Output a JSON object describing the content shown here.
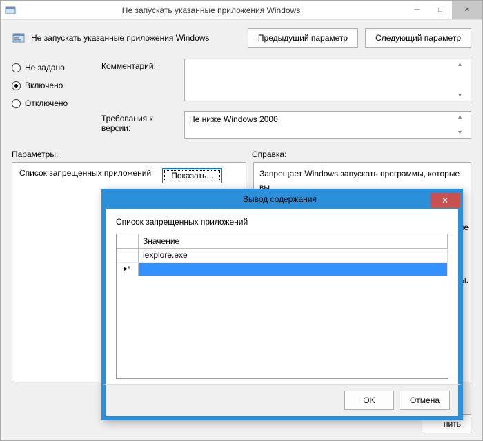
{
  "window": {
    "title": "Не запускать указанные приложения Windows",
    "header_label": "Не запускать указанные приложения Windows",
    "prev_btn": "Предыдущий параметр",
    "next_btn": "Следующий параметр"
  },
  "state": {
    "not_configured": "Не задано",
    "enabled": "Включено",
    "disabled": "Отключено",
    "selected": "enabled"
  },
  "fields": {
    "comment_label": "Комментарий:",
    "comment_value": "",
    "requirements_label": "Требования к версии:",
    "requirements_value": "Не ниже Windows 2000"
  },
  "sections": {
    "params_label": "Параметры:",
    "help_label": "Справка:"
  },
  "params_panel": {
    "list_label": "Список запрещенных приложений",
    "show_btn": "Показать..."
  },
  "help_panel": {
    "line1": "Запрещает Windows запускать программы, которые вы",
    "line2_suffix": "не",
    "line3_suffix": "ы."
  },
  "footer": {
    "apply_suffix": "нить"
  },
  "modal": {
    "title": "Вывод содержания",
    "heading": "Список запрещенных приложений",
    "col_value": "Значение",
    "rows": [
      {
        "value": "iexplore.exe"
      }
    ],
    "ok": "OK",
    "cancel": "Отмена"
  }
}
